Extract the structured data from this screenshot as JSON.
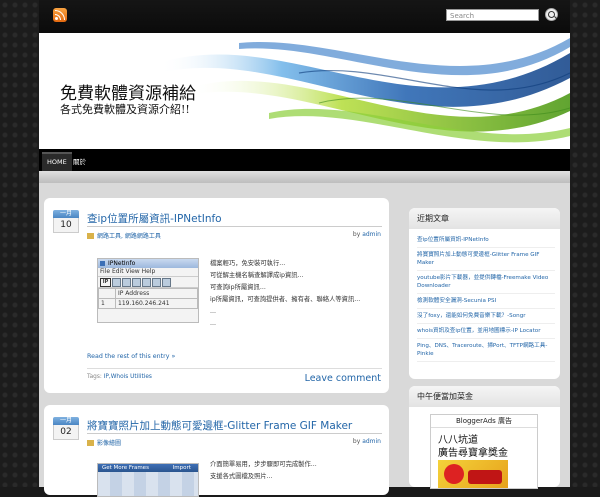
{
  "search": {
    "placeholder": "Search"
  },
  "site": {
    "title": "免費軟體資源補給",
    "description": "各式免費軟體及資源介紹!!"
  },
  "nav": {
    "items": [
      {
        "label": "HOME"
      },
      {
        "label": "關於"
      }
    ]
  },
  "posts": [
    {
      "month": "一月",
      "day": "10",
      "title": "查ip位置所屬資訊-IPNetInfo",
      "category": "網路工具, 網路網路工具",
      "author_prefix": "by ",
      "author": "admin",
      "screenshot": {
        "window_title": "IPNetInfo",
        "menu": "File  Edit  View  Help",
        "toolbar_label": "IP",
        "col_header": "IP Address",
        "row_num": "1",
        "row_ip": "119.160.246.241"
      },
      "lines": [
        "檔案輕巧，免安裝可執行...",
        "可從解主機名稱查解譯成ip資訊...",
        "可查詢ip所屬資訊...",
        "ip所屬資訊，可查詢提供者、擁有者、聯絡人等資訊...",
        "...",
        "..."
      ],
      "read_more": "Read the rest of this entry »",
      "tags_prefix": "Tags: ",
      "tags": "IP,Whois Utilities",
      "leave_comment": "Leave comment"
    },
    {
      "month": "一月",
      "day": "02",
      "title": "將寶寶照片加上動態可愛邊框-Glitter Frame GIF Maker",
      "category": "影像繪圖",
      "author_prefix": "by ",
      "author": "admin",
      "screenshot": {
        "left_label": "Get More Frames",
        "right_label": "Import"
      },
      "lines": [
        "介面簡單易用，步步驟即可完成製作...",
        "支援各式圖檔及照片..."
      ]
    }
  ],
  "sidebar": {
    "recent_title": "近期文章",
    "recent": [
      "查ip位置所屬資訊-IPNetInfo",
      "將寶寶照片加上動態可愛邊框-Glitter Frame GIF Maker",
      "youtube影片下載器，並提供轉檔-Freemake Video Downloader",
      "檢測軟體安全漏洞-Secunia PSI",
      "沒了foxy，還能如何免費音樂下載？-Songr",
      "whois資訊及查ip位置，並用地圖標示-IP Locator",
      "Ping、DNS、Traceroute、掃Port、TFTP網路工具-Pinkie"
    ],
    "ad_title": "中午便當加菜金",
    "ad_header": "BloggerAds 廣告",
    "ad_line1": "八八坑道",
    "ad_line2": "廣告尋寶拿獎金"
  }
}
